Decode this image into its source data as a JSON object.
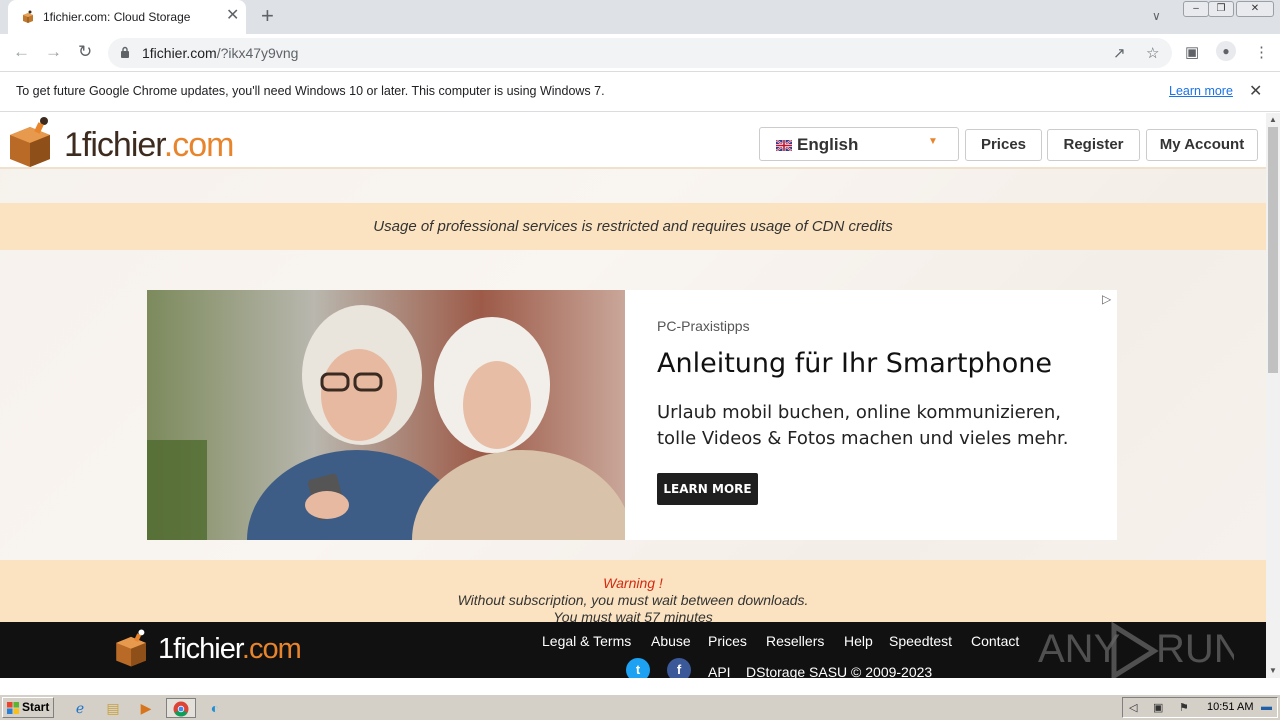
{
  "browser": {
    "tab_title": "1fichier.com: Cloud Storage",
    "tab_close": "✕",
    "new_tab": "+",
    "url_domain": "1fichier.com",
    "url_path": "/?ikx47y9vng"
  },
  "infobar": {
    "message": "To get future Google Chrome updates, you'll need Windows 10 or later. This computer is using Windows 7.",
    "link": "Learn more",
    "close": "✕"
  },
  "site": {
    "logo": {
      "one": "1",
      "name": "fichier",
      "dot_com": ".com"
    },
    "language": "English",
    "nav": [
      "Prices",
      "Register",
      "My Account"
    ],
    "pro_notice": "Usage of professional services is restricted and requires usage of CDN credits"
  },
  "ad": {
    "source": "PC-Praxistipps",
    "headline": "Anleitung für Ihr Smartphone",
    "body": "Urlaub mobil buchen, online kommunizieren, tolle Videos & Fotos machen und vieles mehr.",
    "cta": "LEARN MORE"
  },
  "warning": {
    "title": "Warning !",
    "line1": "Without subscription, you must wait between downloads.",
    "line2": "You must wait 57 minutes"
  },
  "footer": {
    "links": [
      "Legal & Terms",
      "Abuse",
      "Prices",
      "Resellers",
      "Help",
      "Speedtest",
      "Contact"
    ],
    "api": "API",
    "copyright": "DStorage SASU © 2009-2023",
    "twitter": "t",
    "facebook": "f"
  },
  "taskbar": {
    "start": "Start",
    "clock": "10:51 AM"
  },
  "colors": {
    "brand_orange": "#e8852c",
    "notice_band": "#fbe3c1",
    "warning_red": "#d42a12",
    "footer_bg": "#111111"
  }
}
